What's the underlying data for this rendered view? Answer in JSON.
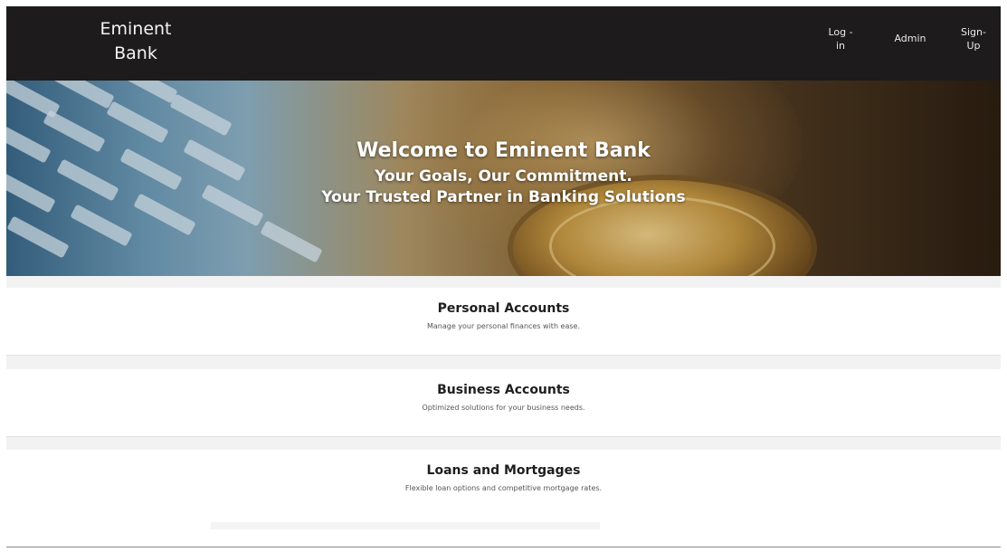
{
  "brand": {
    "line1": "Eminent",
    "line2": "Bank"
  },
  "nav": {
    "login_line1": "Log -",
    "login_line2": "in",
    "admin": "Admin",
    "signup_line1": "Sign-",
    "signup_line2": "Up"
  },
  "hero": {
    "title": "Welcome to Eminent Bank",
    "subtitle1": "Your Goals, Our Commitment.",
    "subtitle2": "Your Trusted Partner in Banking Solutions"
  },
  "services": [
    {
      "title": "Personal Accounts",
      "description": "Manage your personal finances with ease."
    },
    {
      "title": "Business Accounts",
      "description": "Optimized solutions for your business needs."
    },
    {
      "title": "Loans and Mortgages",
      "description": "Flexible loan options and competitive mortgage rates."
    }
  ],
  "colors": {
    "header_bg": "#1d1b1b",
    "page_bg": "#f2f2f2",
    "card_bg": "#ffffff"
  }
}
